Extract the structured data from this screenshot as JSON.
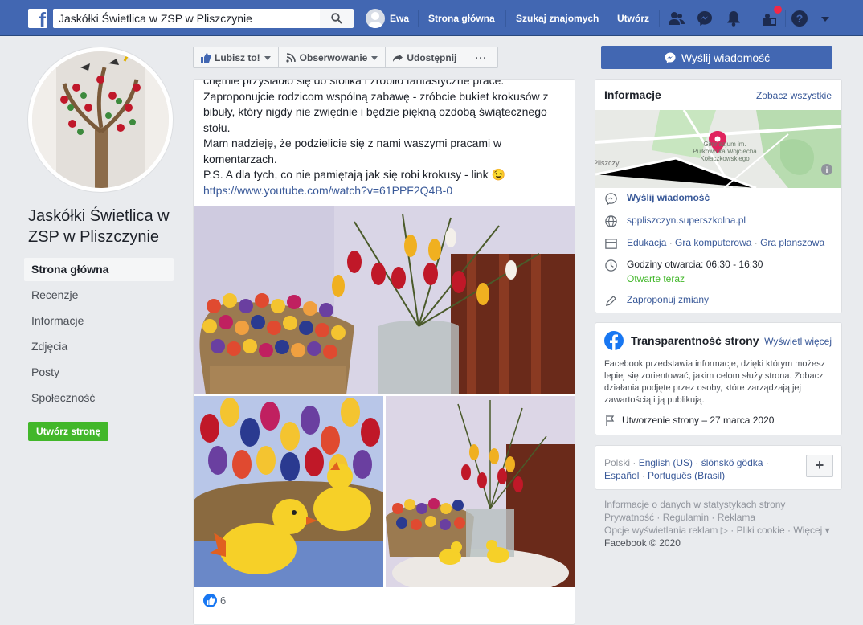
{
  "topbar": {
    "search_value": "Jaskółki Świetlica w ZSP w Pliszczynie",
    "user_name": "Ewa",
    "nav": [
      "Strona główna",
      "Szukaj znajomych",
      "Utwórz"
    ]
  },
  "page": {
    "name": "Jaskółki Świetlica w ZSP w Pliszczynie",
    "nav": [
      "Strona główna",
      "Recenzje",
      "Informacje",
      "Zdjęcia",
      "Posty",
      "Społeczność"
    ],
    "create_page_label": "Utwórz stronę"
  },
  "actions": {
    "like": "Lubisz to!",
    "follow": "Obserwowanie",
    "share": "Udostępnij",
    "more": "···"
  },
  "post": {
    "lines": [
      "chętnie przysiadło się do stolika i zrobiło fantastyczne prace.",
      "Zaproponujcie rodzicom wspólną zabawę - zróbcie bukiet krokusów z bibuły, który nigdy nie zwiędnie i będzie piękną ozdobą świątecznego stołu.",
      "Mam nadzieję, że podzielicie się z nami waszymi pracami w komentarzach.",
      "P.S. A dla tych, co nie pamiętają jak się robi krokusy - link 😉"
    ],
    "link": "https://www.youtube.com/watch?v=61PPF2Q4B-0",
    "likes_count": "6"
  },
  "sidebar": {
    "send_message": "Wyślij wiadomość",
    "info": {
      "title": "Informacje",
      "see_all": "Zobacz wszystkie",
      "map_place": "Gimnazjum im. Pułkownika Wojciecha Kołaczkowskiego",
      "map_left": "Pliszczyn",
      "send_message_row": "Wyślij wiadomość",
      "website": "sppliszczyn.superszkolna.pl",
      "categories": [
        "Edukacja",
        "Gra komputerowa",
        "Gra planszowa"
      ],
      "hours": "Godziny otwarcia: 06:30 - 16:30",
      "open_now": "Otwarte teraz",
      "suggest": "Zaproponuj zmiany"
    },
    "transparency": {
      "title": "Transparentność strony",
      "see_more": "Wyświetl więcej",
      "description": "Facebook przedstawia informacje, dzięki którym możesz lepiej się zorientować, jakim celom służy strona. Zobacz działania podjęte przez osoby, które zarządzają jej zawartością i ją publikują.",
      "created": "Utworzenie strony – 27 marca 2020"
    },
    "languages": {
      "current": "Polski",
      "others": [
        "English (US)",
        "ślōnskŏ gŏdka",
        "Español",
        "Português (Brasil)"
      ]
    },
    "footer": {
      "line1": "Informacje o danych w statystykach strony",
      "links": [
        "Prywatność",
        "Regulamin",
        "Reklama",
        "Opcje wyświetlania reklam",
        "Pliki cookie",
        "Więcej"
      ],
      "copyright": "Facebook © 2020"
    }
  },
  "colors": {
    "brand": "#4267b2",
    "link": "#385898",
    "green": "#42b72a"
  }
}
